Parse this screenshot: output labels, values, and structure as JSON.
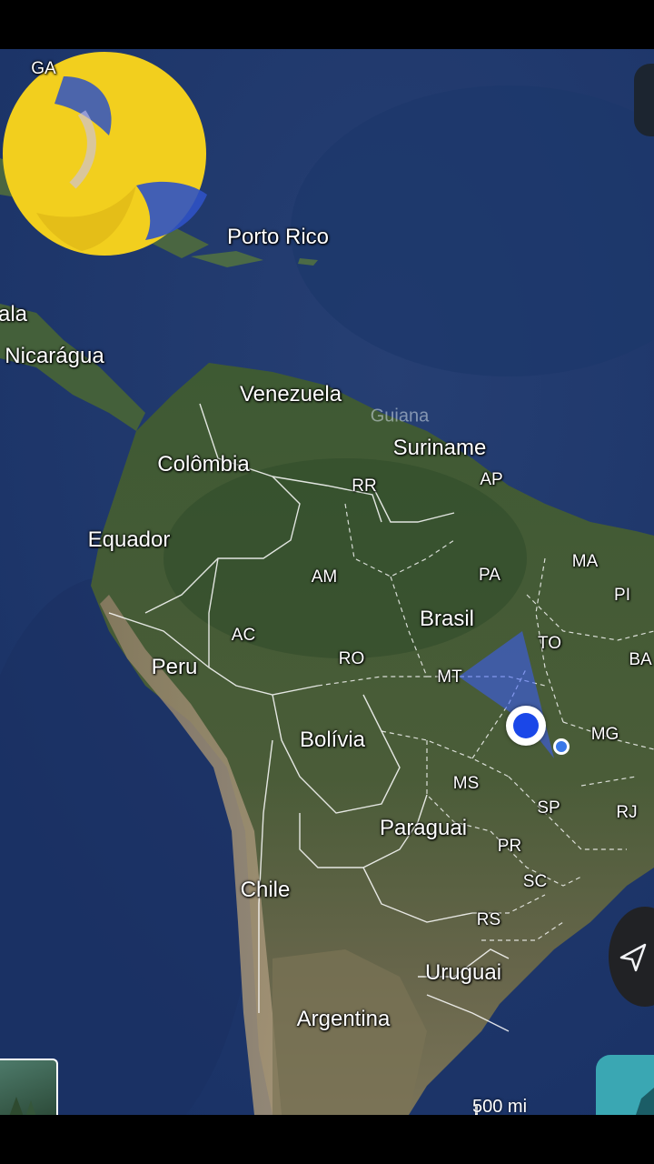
{
  "map": {
    "style": "satellite",
    "countries": [
      {
        "id": "ga",
        "text": "GA"
      },
      {
        "id": "porto-rico",
        "text": "Porto Rico"
      },
      {
        "id": "guatemala-partial",
        "text": "ala"
      },
      {
        "id": "nicaragua",
        "text": "Nicarágua"
      },
      {
        "id": "venezuela",
        "text": "Venezuela"
      },
      {
        "id": "guiana",
        "text": "Guiana"
      },
      {
        "id": "suriname",
        "text": "Suriname"
      },
      {
        "id": "colombia",
        "text": "Colômbia"
      },
      {
        "id": "equador",
        "text": "Equador"
      },
      {
        "id": "brasil",
        "text": "Brasil"
      },
      {
        "id": "peru",
        "text": "Peru"
      },
      {
        "id": "bolivia",
        "text": "Bolívia"
      },
      {
        "id": "paraguai",
        "text": "Paraguai"
      },
      {
        "id": "chile",
        "text": "Chile"
      },
      {
        "id": "uruguai",
        "text": "Uruguai"
      },
      {
        "id": "argentina",
        "text": "Argentina"
      }
    ],
    "states": [
      {
        "id": "rr",
        "text": "RR"
      },
      {
        "id": "ap",
        "text": "AP"
      },
      {
        "id": "am",
        "text": "AM"
      },
      {
        "id": "pa",
        "text": "PA"
      },
      {
        "id": "ma",
        "text": "MA"
      },
      {
        "id": "pi",
        "text": "PI"
      },
      {
        "id": "ac",
        "text": "AC"
      },
      {
        "id": "ro",
        "text": "RO"
      },
      {
        "id": "to",
        "text": "TO"
      },
      {
        "id": "ba",
        "text": "BA"
      },
      {
        "id": "mt",
        "text": "MT"
      },
      {
        "id": "mg",
        "text": "MG"
      },
      {
        "id": "ms",
        "text": "MS"
      },
      {
        "id": "sp",
        "text": "SP"
      },
      {
        "id": "rj",
        "text": "RJ"
      },
      {
        "id": "pr",
        "text": "PR"
      },
      {
        "id": "sc",
        "text": "SC"
      },
      {
        "id": "rs",
        "text": "RS"
      }
    ],
    "scale": "500 mi",
    "colors": {
      "ocean": "#1f3b6e",
      "land": "#3f5a34",
      "location_dot": "#1a47e8",
      "location_beam": "#3a5cff",
      "ball_yellow": "#f2cf1e",
      "ball_blue": "#2f52c4",
      "nav_button": "#3aa7b3"
    }
  },
  "icons": [
    "volleyball-icon",
    "my-location-icon",
    "compass-icon",
    "layers-icon",
    "navigation-icon"
  ]
}
